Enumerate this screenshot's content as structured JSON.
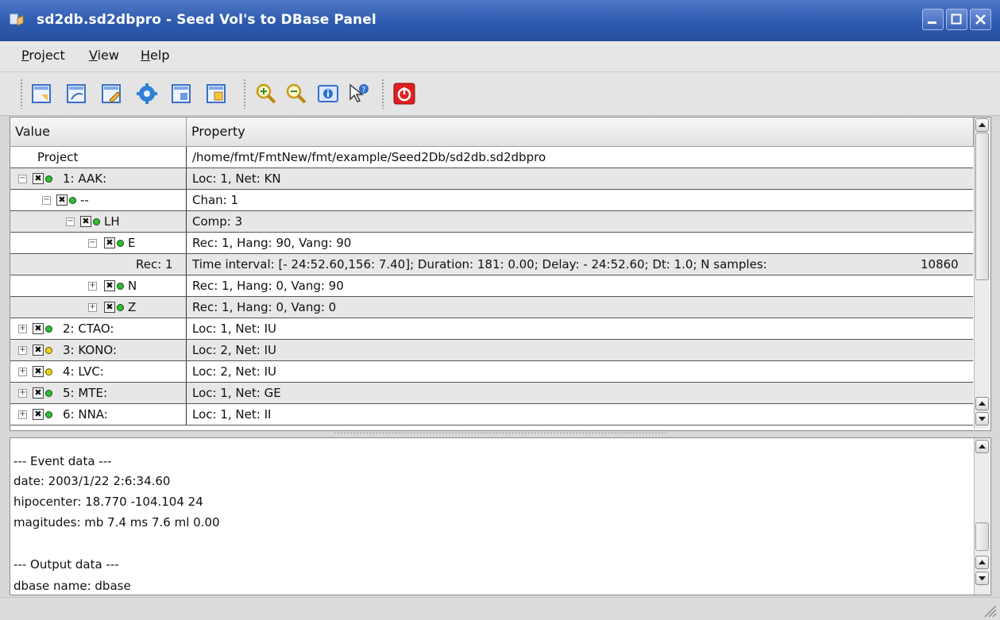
{
  "window": {
    "title": "sd2db.sd2dbpro - Seed Vol's to DBase Panel",
    "icon": "app-icon",
    "controls": [
      "minimize-icon",
      "maximize-icon",
      "close-icon"
    ]
  },
  "menu": [
    {
      "underline": "P",
      "rest": "roject"
    },
    {
      "underline": "V",
      "rest": "iew"
    },
    {
      "underline": "H",
      "rest": "elp"
    }
  ],
  "toolbar": {
    "group1": [
      "new-project-icon",
      "open-project-icon",
      "edit-project-icon",
      "process-icon",
      "import-icon",
      "export-icon"
    ],
    "group2": [
      "zoom-in-icon",
      "zoom-out-icon",
      "info-icon",
      "help-pointer-icon"
    ],
    "group3": [
      "power-exit-icon"
    ],
    "accent_exit": "#e02020"
  },
  "tree": {
    "columns": [
      "Value",
      "Property"
    ],
    "rows": [
      {
        "value": "Project",
        "property": "/home/fmt/FmtNew/fmt/example/Seed2Db/sd2db.sd2dbpro"
      },
      {
        "value": "1: AAK:",
        "property": "Loc: 1, Net: KN",
        "expander": "−",
        "status": "green"
      },
      {
        "value": "--",
        "property": "Chan: 1",
        "expander": "−",
        "status": "green"
      },
      {
        "value": "LH",
        "property": "Comp: 3",
        "expander": "−",
        "status": "green"
      },
      {
        "value": "E",
        "property": "Rec: 1, Hang: 90, Vang: 90",
        "expander": "−",
        "status": "green"
      },
      {
        "value": "Rec: 1",
        "property": "Time interval: [- 24:52.60,156: 7.40]; Duration: 181: 0.00; Delay: - 24:52.60; Dt:  1.0; N samples:",
        "extra": "10860"
      },
      {
        "value": "N",
        "property": "Rec: 1, Hang: 0, Vang: 90",
        "expander": "+",
        "status": "green"
      },
      {
        "value": "Z",
        "property": "Rec: 1, Hang: 0, Vang: 0",
        "expander": "+",
        "status": "green"
      },
      {
        "value": "2: CTAO:",
        "property": "Loc: 1, Net: IU",
        "expander": "+",
        "status": "green"
      },
      {
        "value": "3: KONO:",
        "property": "Loc: 2, Net: IU",
        "expander": "+",
        "status": "yellow"
      },
      {
        "value": "4: LVC:",
        "property": "Loc: 2, Net: IU",
        "expander": "+",
        "status": "yellow"
      },
      {
        "value": "5: MTE:",
        "property": "Loc: 1, Net: GE",
        "expander": "+",
        "status": "green"
      },
      {
        "value": "6: NNA:",
        "property": "Loc: 1, Net: II",
        "expander": "+",
        "status": "green"
      }
    ]
  },
  "console": {
    "lines": [
      "--- Event data ---",
      "date: 2003/1/22  2:6:34.60",
      "hipocenter:  18.770 -104.104 24",
      "magitudes:  mb 7.4 ms 7.6 ml 0.00",
      "",
      "--- Output data ---",
      "dbase name: dbase"
    ]
  }
}
